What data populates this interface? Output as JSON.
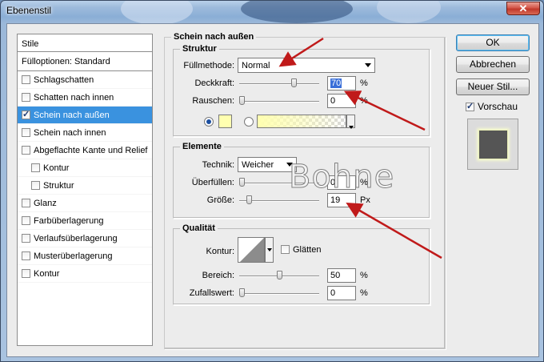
{
  "window": {
    "title": "Ebenenstil",
    "close_glyph": "✕"
  },
  "styles_list": {
    "header": "Stile",
    "options": "Fülloptionen: Standard",
    "items": [
      {
        "label": "Schlagschatten",
        "checked": false,
        "sub": false,
        "selected": false
      },
      {
        "label": "Schatten nach innen",
        "checked": false,
        "sub": false,
        "selected": false
      },
      {
        "label": "Schein nach außen",
        "checked": true,
        "sub": false,
        "selected": true
      },
      {
        "label": "Schein nach innen",
        "checked": false,
        "sub": false,
        "selected": false
      },
      {
        "label": "Abgeflachte Kante und Relief",
        "checked": false,
        "sub": false,
        "selected": false
      },
      {
        "label": "Kontur",
        "checked": false,
        "sub": true,
        "selected": false
      },
      {
        "label": "Struktur",
        "checked": false,
        "sub": true,
        "selected": false
      },
      {
        "label": "Glanz",
        "checked": false,
        "sub": false,
        "selected": false
      },
      {
        "label": "Farbüberlagerung",
        "checked": false,
        "sub": false,
        "selected": false
      },
      {
        "label": "Verlaufsüberlagerung",
        "checked": false,
        "sub": false,
        "selected": false
      },
      {
        "label": "Musterüberlagerung",
        "checked": false,
        "sub": false,
        "selected": false
      },
      {
        "label": "Kontur",
        "checked": false,
        "sub": false,
        "selected": false
      }
    ]
  },
  "panel": {
    "title": "Schein nach außen",
    "struktur": {
      "legend": "Struktur",
      "blend_label": "Füllmethode:",
      "blend_value": "Normal",
      "opacity_label": "Deckkraft:",
      "opacity_value": "70",
      "opacity_unit": "%",
      "opacity_level": 0.7,
      "noise_label": "Rauschen:",
      "noise_value": "0",
      "noise_unit": "%",
      "noise_level": 0,
      "glow_color": "#ffffb0"
    },
    "elemente": {
      "legend": "Elemente",
      "technique_label": "Technik:",
      "technique_value": "Weicher",
      "spread_label": "Überfüllen:",
      "spread_value": "0",
      "spread_unit": "%",
      "spread_level": 0,
      "size_label": "Größe:",
      "size_value": "19",
      "size_unit": "Px",
      "size_level": 0.1
    },
    "qualitaet": {
      "legend": "Qualität",
      "contour_label": "Kontur:",
      "antialias_label": "Glätten",
      "antialias_checked": false,
      "range_label": "Bereich:",
      "range_value": "50",
      "range_unit": "%",
      "range_level": 0.5,
      "jitter_label": "Zufallswert:",
      "jitter_value": "0",
      "jitter_unit": "%",
      "jitter_level": 0
    }
  },
  "buttons": {
    "ok": "OK",
    "cancel": "Abbrechen",
    "new_style": "Neuer Stil..."
  },
  "preview": {
    "label": "Vorschau",
    "checked": true
  },
  "watermark": "Bohne",
  "accent": "#3a92df",
  "arrow_color": "#c01a1a"
}
